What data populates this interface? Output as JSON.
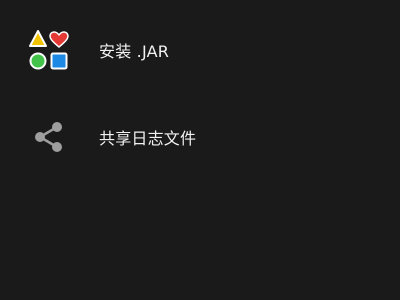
{
  "menu": {
    "items": [
      {
        "label": "安装 .JAR",
        "icon": "shapes-icon"
      },
      {
        "label": "共享日志文件",
        "icon": "share-icon"
      }
    ]
  },
  "colors": {
    "background": "#1a1a1a",
    "text": "#f2f2f2",
    "triangle": "#f2c300",
    "heart": "#e53935",
    "circle": "#43c34a",
    "square": "#1e88e5",
    "share": "#9e9e9e"
  }
}
